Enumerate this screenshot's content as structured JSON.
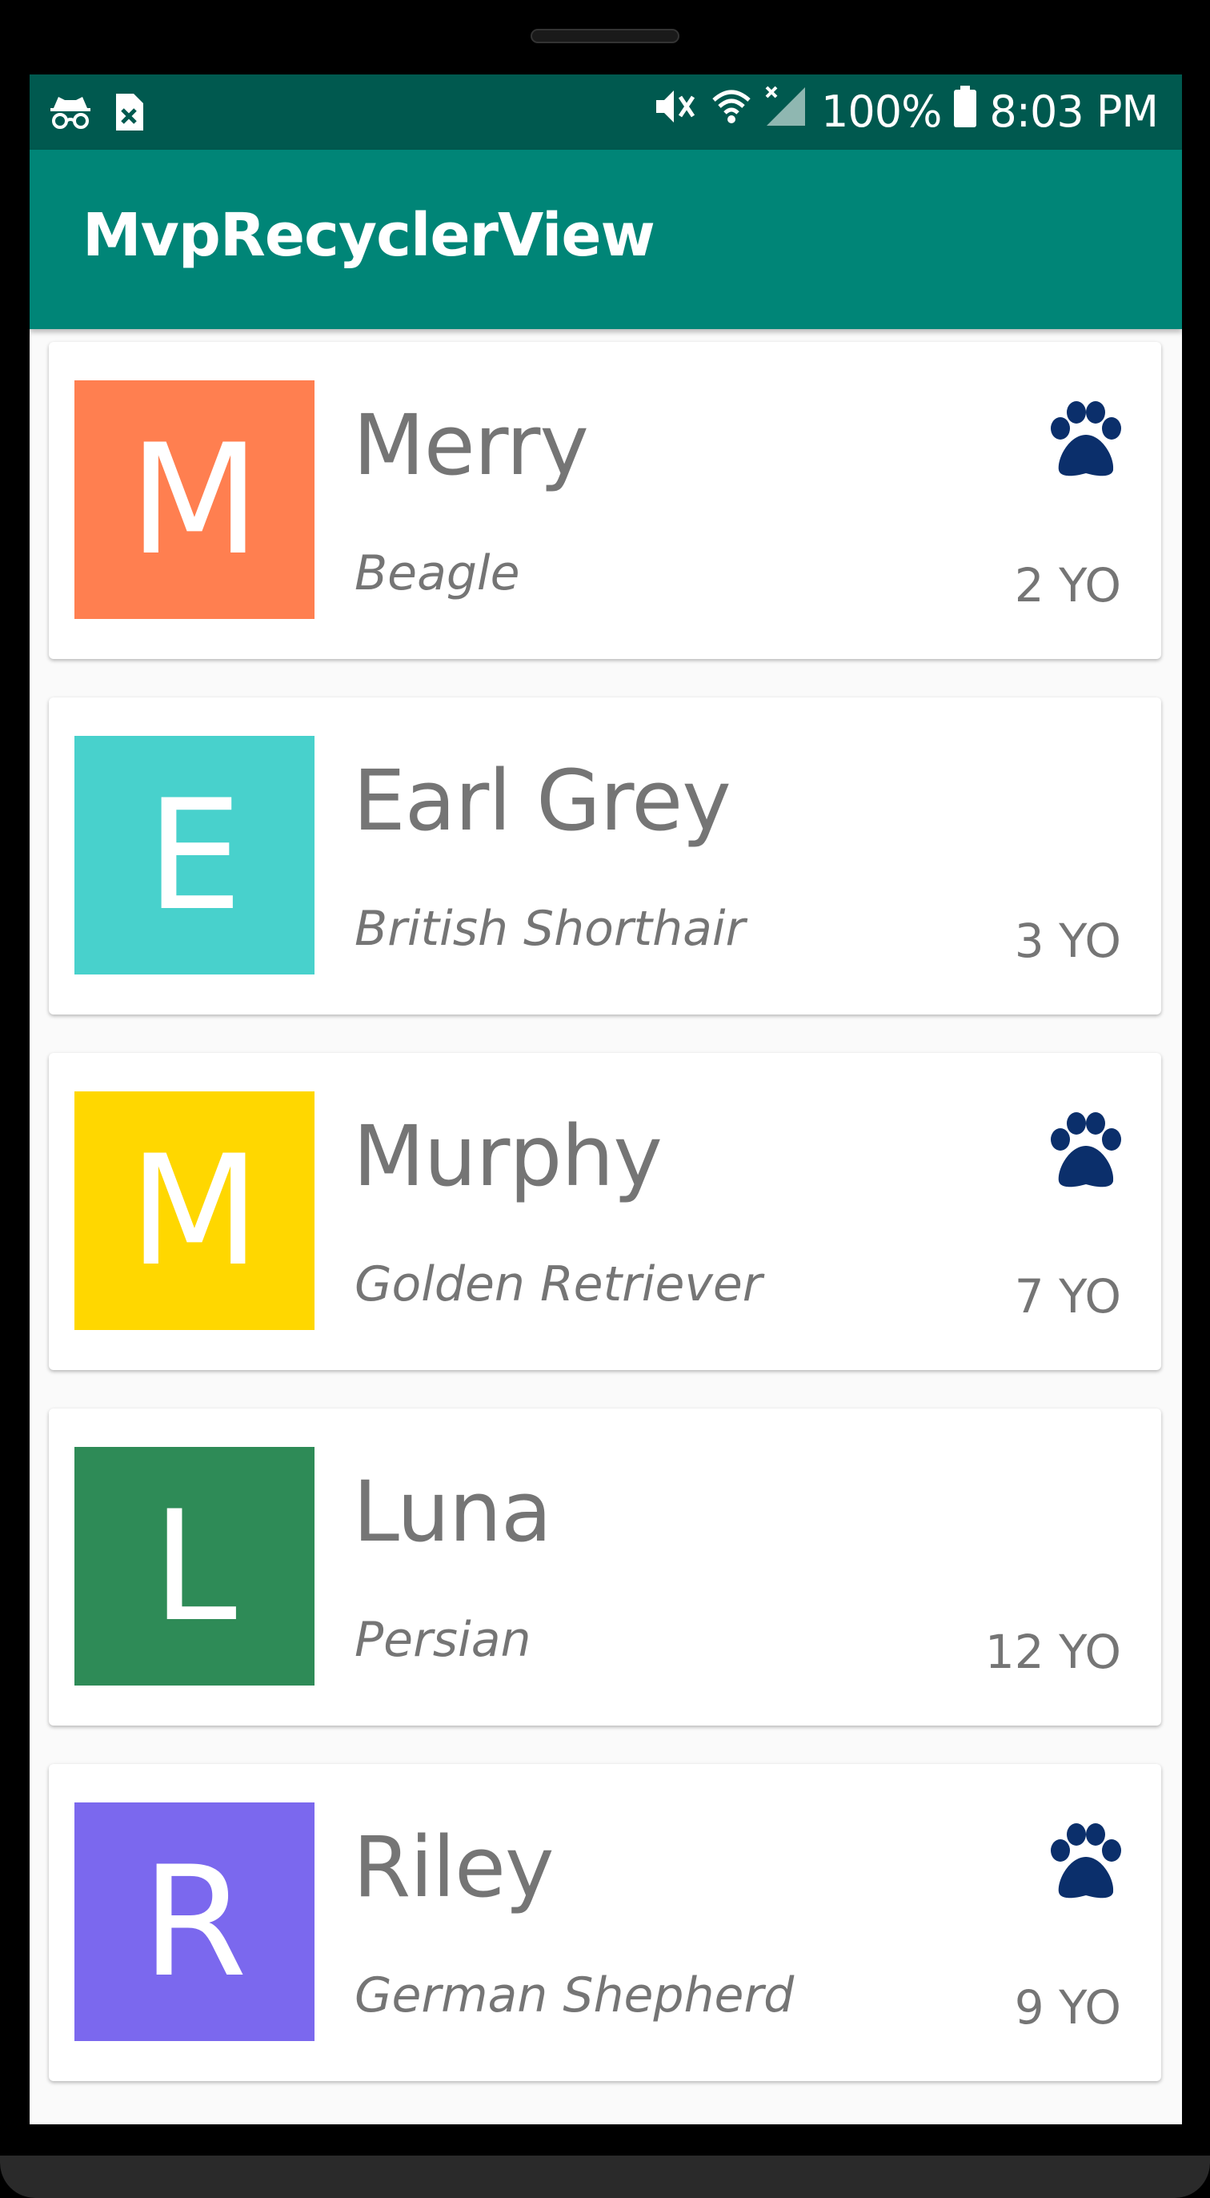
{
  "status_bar": {
    "battery": "100%",
    "time": "8:03 PM",
    "icons": [
      "incognito-icon",
      "file-x-icon",
      "vibrate-mute-icon",
      "wifi-icon",
      "signal-icon",
      "battery-icon"
    ]
  },
  "app_bar": {
    "title": "MvpRecyclerView",
    "color": "#008577",
    "status_color": "#00594f"
  },
  "pets": [
    {
      "initial": "M",
      "name": "Merry",
      "breed": "Beagle",
      "age": "2 YO",
      "color": "#ff7f50",
      "is_dog": true
    },
    {
      "initial": "E",
      "name": "Earl Grey",
      "breed": "British Shorthair",
      "age": "3 YO",
      "color": "#48d1cc",
      "is_dog": false
    },
    {
      "initial": "M",
      "name": "Murphy",
      "breed": "Golden Retriever",
      "age": "7 YO",
      "color": "#ffd700",
      "is_dog": true
    },
    {
      "initial": "L",
      "name": "Luna",
      "breed": "Persian",
      "age": "12 YO",
      "color": "#2e8b57",
      "is_dog": false
    },
    {
      "initial": "R",
      "name": "Riley",
      "breed": "German Shepherd",
      "age": "9 YO",
      "color": "#7b68ee",
      "is_dog": true
    }
  ],
  "paw_color": "#0b2f6b"
}
